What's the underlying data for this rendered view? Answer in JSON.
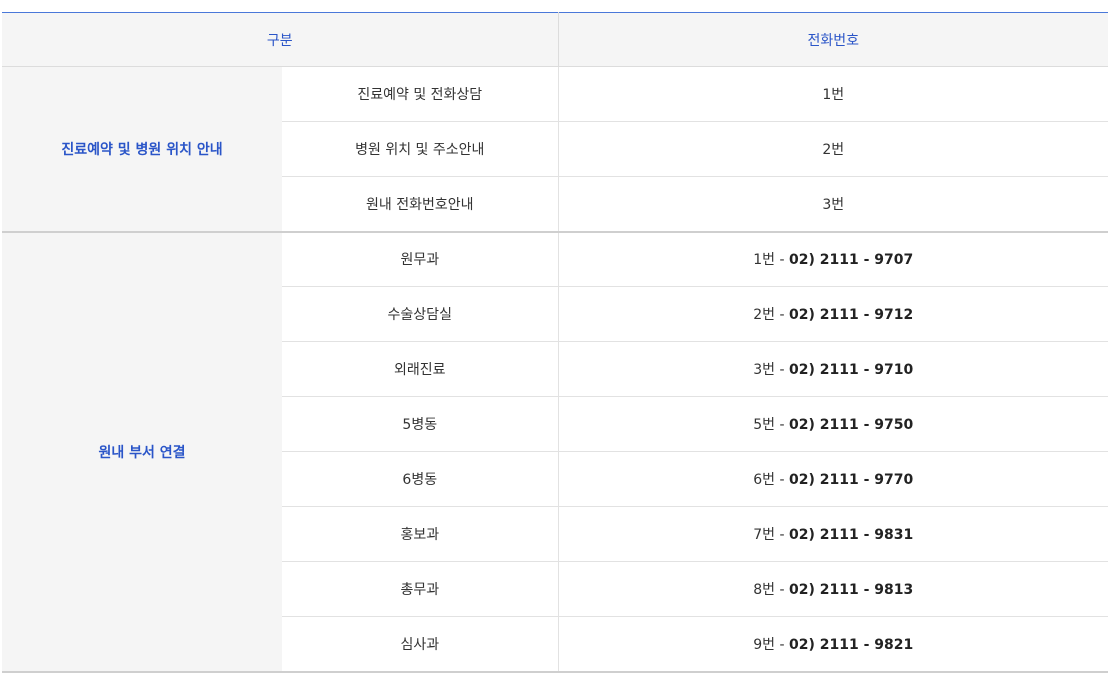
{
  "header": {
    "category": "구분",
    "phone": "전화번호"
  },
  "groups": [
    {
      "name": "진료예약 및 병원 위치 안내",
      "rows": [
        {
          "item": "진료예약 및 전화상담",
          "ext": "1번",
          "phone": ""
        },
        {
          "item": "병원 위치 및 주소안내",
          "ext": "2번",
          "phone": ""
        },
        {
          "item": "원내 전화번호안내",
          "ext": "3번",
          "phone": ""
        }
      ]
    },
    {
      "name": "원내 부서 연결",
      "rows": [
        {
          "item": "원무과",
          "ext": "1번 - ",
          "phone": "02) 2111 - 9707"
        },
        {
          "item": "수술상담실",
          "ext": "2번 - ",
          "phone": "02) 2111 - 9712"
        },
        {
          "item": "외래진료",
          "ext": "3번 - ",
          "phone": "02) 2111 - 9710"
        },
        {
          "item": "5병동",
          "ext": "5번 - ",
          "phone": "02) 2111 - 9750"
        },
        {
          "item": "6병동",
          "ext": "6번 - ",
          "phone": "02) 2111 - 9770"
        },
        {
          "item": "홍보과",
          "ext": "7번 - ",
          "phone": "02) 2111 - 9831"
        },
        {
          "item": "총무과",
          "ext": "8번 - ",
          "phone": "02) 2111 - 9813"
        },
        {
          "item": "심사과",
          "ext": "9번 - ",
          "phone": "02) 2111 - 9821"
        }
      ]
    }
  ],
  "colors": {
    "accent": "#2a55c8",
    "header_bg": "#f5f5f5",
    "top_border": "#4a78d9"
  }
}
